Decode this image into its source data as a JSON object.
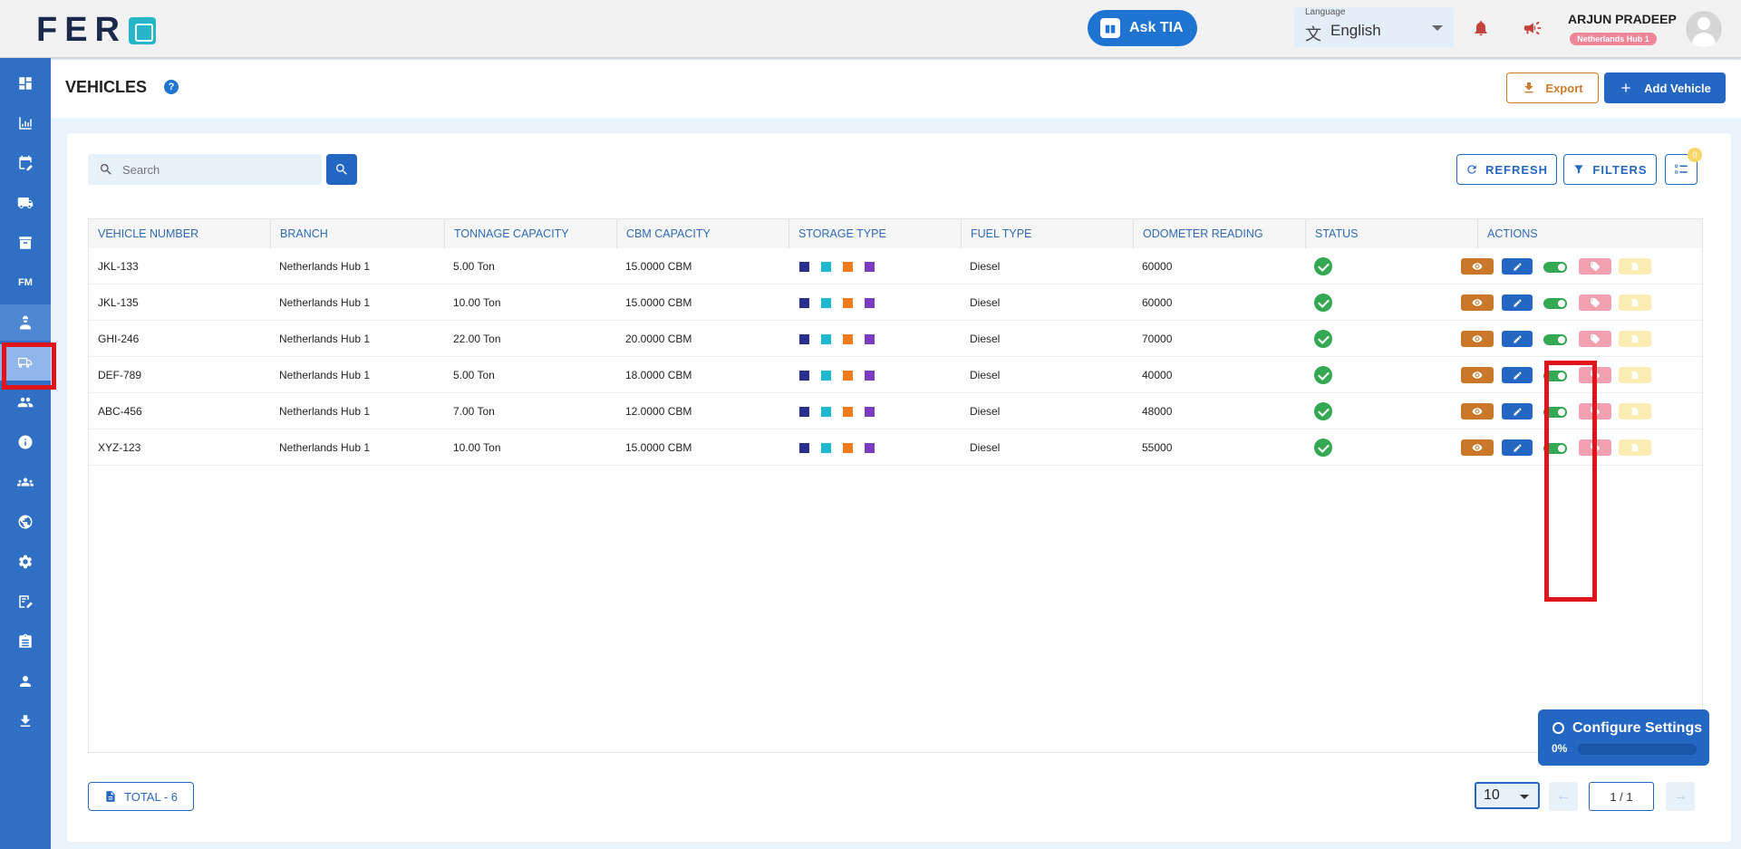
{
  "header": {
    "logo_text": "FER",
    "ask_label": "Ask TIA",
    "language_label": "Language",
    "language_value": "English",
    "user_name": "ARJUN PRADEEP",
    "user_hub": "Netherlands Hub 1"
  },
  "sidebar": {
    "items": [
      {
        "icon": "dashboard-icon"
      },
      {
        "icon": "analytics-icon"
      },
      {
        "icon": "calendar-edit-icon"
      },
      {
        "icon": "delivery-truck-icon"
      },
      {
        "icon": "archive-icon"
      },
      {
        "icon": "fm-icon",
        "label": "FM"
      },
      {
        "icon": "driver-icon"
      },
      {
        "icon": "vehicle-icon",
        "active": true
      },
      {
        "icon": "users-icon"
      },
      {
        "icon": "info-icon"
      },
      {
        "icon": "groups-icon"
      },
      {
        "icon": "globe-icon"
      },
      {
        "icon": "settings-icon"
      },
      {
        "icon": "edit-note-icon"
      },
      {
        "icon": "clipboard-icon"
      },
      {
        "icon": "person-icon"
      },
      {
        "icon": "download-icon"
      }
    ]
  },
  "page": {
    "title": "VEHICLES",
    "export_label": "Export",
    "add_label": "Add Vehicle"
  },
  "toolbar": {
    "search_placeholder": "Search",
    "refresh_label": "REFRESH",
    "filters_label": "FILTERS",
    "columns_badge": "0"
  },
  "table": {
    "headers": [
      "VEHICLE NUMBER",
      "BRANCH",
      "TONNAGE CAPACITY",
      "CBM CAPACITY",
      "STORAGE TYPE",
      "FUEL TYPE",
      "ODOMETER READING",
      "STATUS",
      "ACTIONS"
    ],
    "storage_colors": [
      "#2b2f8c",
      "#1cb8d1",
      "#f07b1c",
      "#7a3cc3"
    ],
    "rows": [
      {
        "vehicle": "JKL-133",
        "branch": "Netherlands Hub 1",
        "tonnage": "5.00 Ton",
        "cbm": "15.0000 CBM",
        "fuel": "Diesel",
        "odometer": "60000"
      },
      {
        "vehicle": "JKL-135",
        "branch": "Netherlands Hub 1",
        "tonnage": "10.00 Ton",
        "cbm": "15.0000 CBM",
        "fuel": "Diesel",
        "odometer": "60000"
      },
      {
        "vehicle": "GHI-246",
        "branch": "Netherlands Hub 1",
        "tonnage": "22.00 Ton",
        "cbm": "20.0000 CBM",
        "fuel": "Diesel",
        "odometer": "70000"
      },
      {
        "vehicle": "DEF-789",
        "branch": "Netherlands Hub 1",
        "tonnage": "5.00 Ton",
        "cbm": "18.0000 CBM",
        "fuel": "Diesel",
        "odometer": "40000"
      },
      {
        "vehicle": "ABC-456",
        "branch": "Netherlands Hub 1",
        "tonnage": "7.00 Ton",
        "cbm": "12.0000 CBM",
        "fuel": "Diesel",
        "odometer": "48000"
      },
      {
        "vehicle": "XYZ-123",
        "branch": "Netherlands Hub 1",
        "tonnage": "10.00 Ton",
        "cbm": "15.0000 CBM",
        "fuel": "Diesel",
        "odometer": "55000"
      }
    ]
  },
  "footer": {
    "total_label": "TOTAL  - 6",
    "page_size": "10",
    "page_indicator": "1 / 1"
  },
  "config": {
    "title": "Configure Settings",
    "percent": "0%"
  },
  "colors": {
    "primary": "#2467c3",
    "sidebar": "#2f6fc4",
    "export": "#cf7b2a",
    "status_ok": "#34a853",
    "highlight": "#e2141b"
  }
}
